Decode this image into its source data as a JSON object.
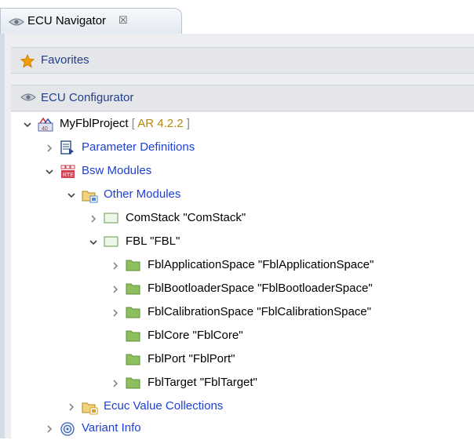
{
  "tab": {
    "title": "ECU Navigator",
    "close_glyph": "☒"
  },
  "sections": {
    "favorites": "Favorites",
    "configurator": "ECU Configurator"
  },
  "tree": {
    "project": {
      "name": "MyFblProject",
      "version_prefix": " [ ",
      "version": "AR 4.2.2",
      "version_suffix": " ]"
    },
    "parameter_definitions": "Parameter Definitions",
    "bsw_modules": "Bsw Modules",
    "other_modules": "Other Modules",
    "comstack": "ComStack \"ComStack\"",
    "fbl": "FBL \"FBL\"",
    "fbl_application_space": "FblApplicationSpace \"FblApplicationSpace\"",
    "fbl_bootloader_space": "FblBootloaderSpace \"FblBootloaderSpace\"",
    "fbl_calibration_space": "FblCalibrationSpace \"FblCalibrationSpace\"",
    "fbl_core": "FblCore \"FblCore\"",
    "fbl_port": "FblPort \"FblPort\"",
    "fbl_target": "FblTarget \"FblTarget\"",
    "ecuc_value_collections": "Ecuc Value Collections",
    "variant_info": "Variant Info"
  }
}
